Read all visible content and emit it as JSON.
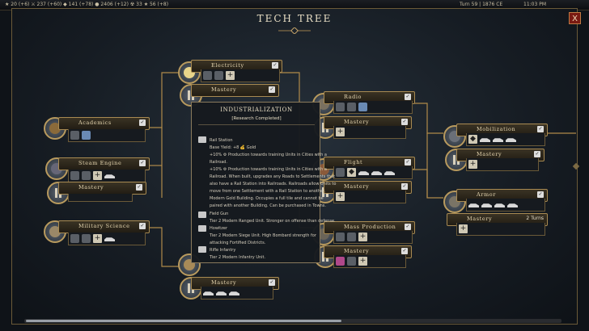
{
  "topbar": {
    "left_stats": "★ 20 (+6) ⚔ 237 (+60) ◆ 141 (+78) ● 2406 (+12) ☢ 33 ★ 56 (+8)",
    "turn": "Turn 59 | 1876 CE",
    "time": "11:03 PM"
  },
  "title": "TECH TREE",
  "close_label": "X",
  "nodes": {
    "electricity": {
      "label": "Electricity"
    },
    "electricity_mastery": {
      "label": "Mastery"
    },
    "academics": {
      "label": "Academics"
    },
    "steam_engine": {
      "label": "Steam Engine"
    },
    "steam_mastery": {
      "label": "Mastery"
    },
    "military_science": {
      "label": "Military Science"
    },
    "radio": {
      "label": "Radio"
    },
    "radio_mastery": {
      "label": "Mastery"
    },
    "flight": {
      "label": "Flight"
    },
    "flight_mastery": {
      "label": "Mastery"
    },
    "mass_production": {
      "label": "Mass Production"
    },
    "mass_mastery": {
      "label": "Mastery"
    },
    "industrial_mastery": {
      "label": "Mastery"
    },
    "mobilization": {
      "label": "Mobilization"
    },
    "mobilization_mastery": {
      "label": "Mastery"
    },
    "armor": {
      "label": "Armor"
    },
    "armor_mastery": {
      "label": "Mastery",
      "turns": "2 Turns"
    }
  },
  "tooltip": {
    "title": "INDUSTRIALIZATION",
    "status": "[Research Completed]",
    "lines": [
      "Rail Station",
      "Base Yield: +8 💰 Gold",
      "+10% ⚙ Production towards training Units in Cities with a",
      "Railroad.",
      "+10% ⚙ Production towards training Units in Cities with a",
      "Railroad. When built, upgrades any Roads to Settlements that",
      "also have a Rail Station into Railroads. Railroads allow Units to",
      "move from one Settlement with a Rail Station to another.",
      "Modern Gold Building. Occupies a full tile and cannot be",
      "paired with another Building. Can be purchased in Towns.",
      "Field Gun",
      "Tier 2 Modern Ranged Unit. Stronger on offense than defense.",
      "Howitzer",
      "Tier 2 Modern Siege Unit. High Bombard strength for",
      "attacking Fortified Districts.",
      "Rifle Infantry",
      "Tier 2 Modern Infantry Unit."
    ]
  }
}
